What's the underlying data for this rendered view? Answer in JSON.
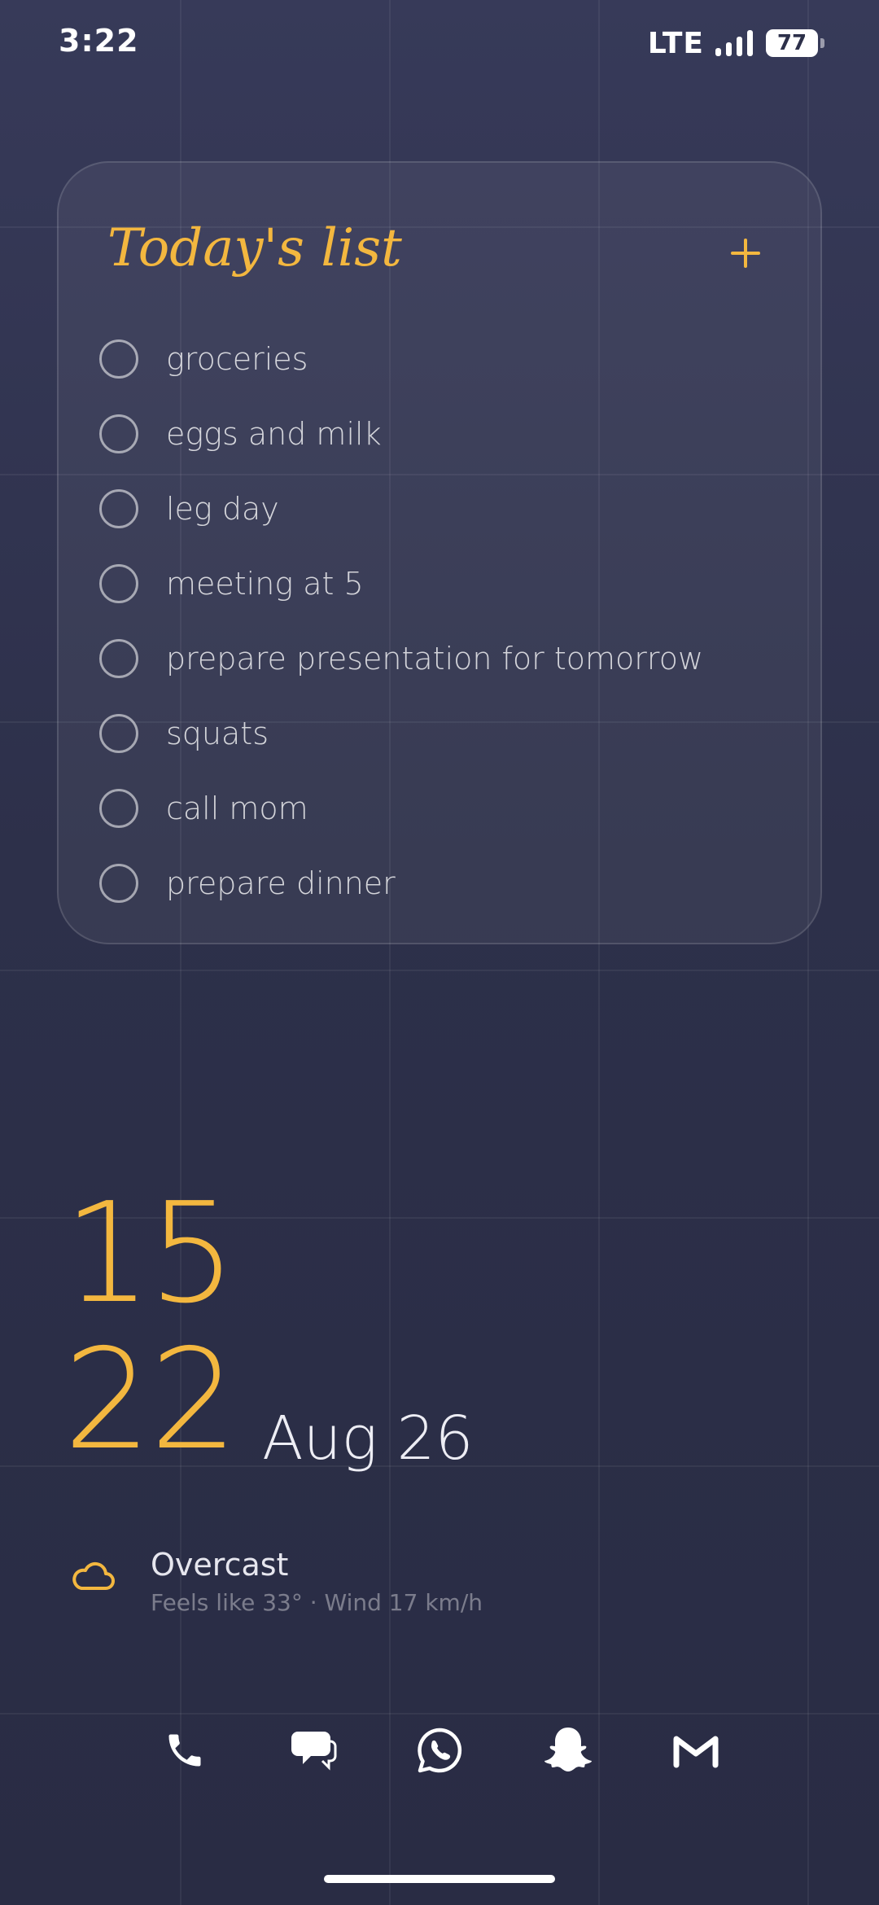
{
  "status_bar": {
    "time": "3:22",
    "network": "LTE",
    "battery": "77"
  },
  "todo_widget": {
    "title": "Today's list",
    "add_icon": "plus-icon",
    "items": [
      {
        "label": "groceries",
        "checked": false
      },
      {
        "label": "eggs and milk",
        "checked": false
      },
      {
        "label": "leg day",
        "checked": false
      },
      {
        "label": "meeting at 5",
        "checked": false
      },
      {
        "label": "prepare presentation for tomorrow",
        "checked": false
      },
      {
        "label": "squats",
        "checked": false
      },
      {
        "label": "call mom",
        "checked": false
      },
      {
        "label": "prepare dinner",
        "checked": false
      }
    ]
  },
  "clock": {
    "hour": "15",
    "minute": "22",
    "date": "Aug 26"
  },
  "weather": {
    "icon": "cloud-icon",
    "condition": "Overcast",
    "details": "Feels like 33° · Wind 17 km/h"
  },
  "dock": {
    "apps": [
      "phone-icon",
      "messages-icon",
      "whatsapp-icon",
      "snapchat-icon",
      "gmail-icon"
    ]
  },
  "colors": {
    "accent": "#f3b73f",
    "background": "#2d304a",
    "text": "#e4e4ee"
  }
}
